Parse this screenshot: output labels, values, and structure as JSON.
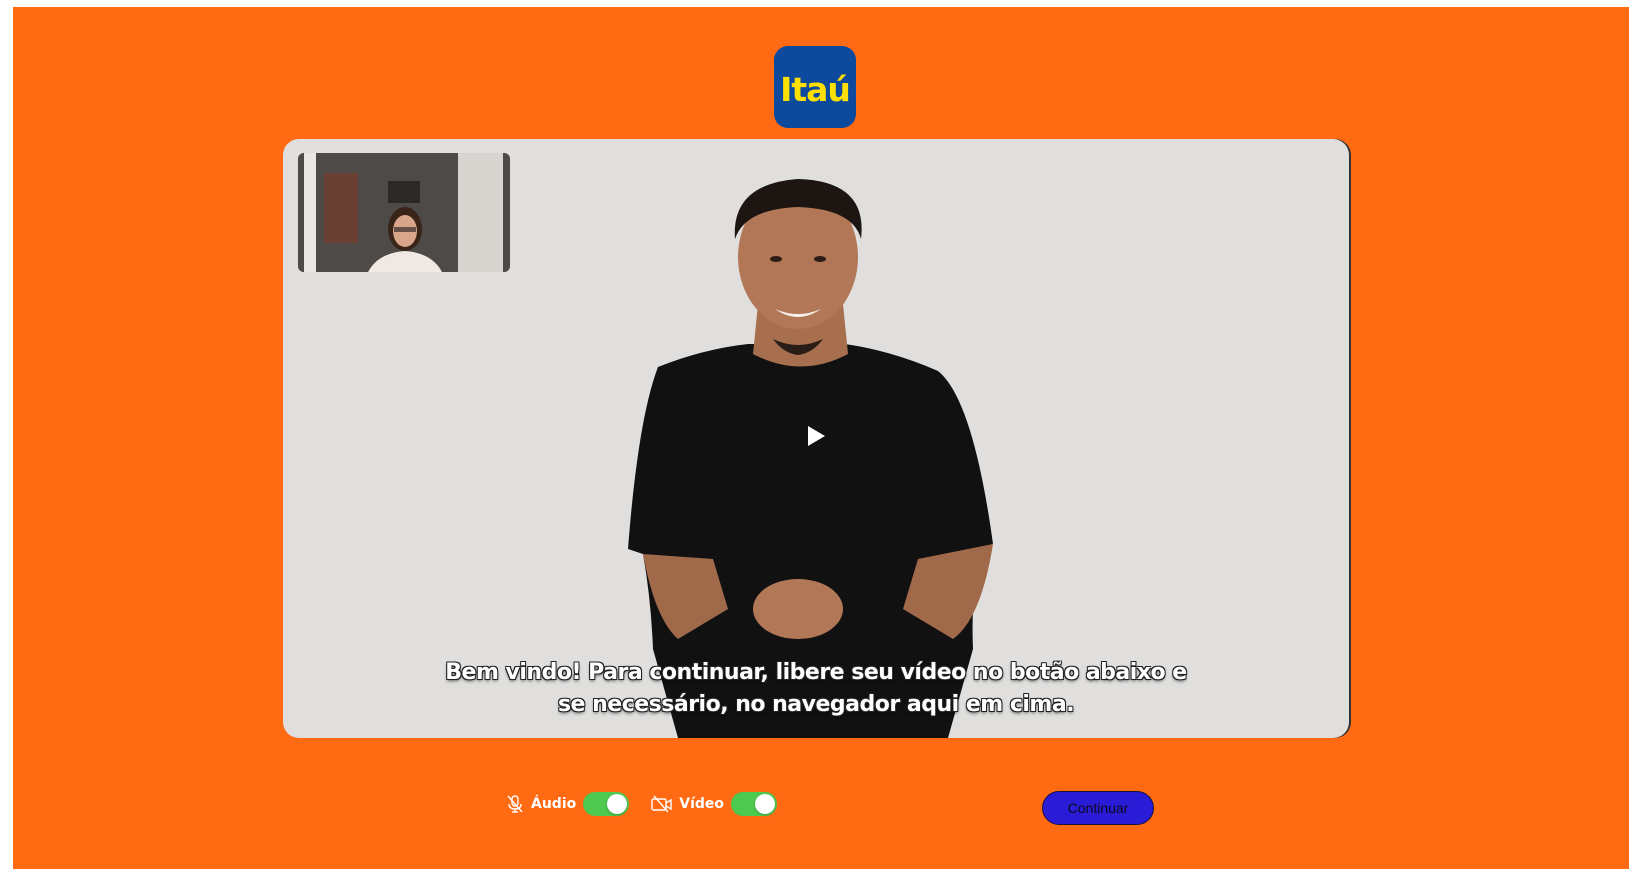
{
  "brand": {
    "logo_text": "Itaú",
    "logo_bg": "#0d4a9e",
    "logo_fg": "#ffe000"
  },
  "theme": {
    "page_bg": "#ff6a13",
    "player_bg": "#e0dfdd",
    "toggle_on": "#4cc94e",
    "button_bg": "#2a1bd6"
  },
  "player": {
    "subtitle_line1": "Bem vindo! Para continuar, libere seu vídeo no botão abaixo e",
    "subtitle_line2": "se necessário, no navegador aqui em cima.",
    "play_icon": "play-icon",
    "self_view_icon": "webcam-preview"
  },
  "controls": {
    "audio": {
      "label": "Áudio",
      "icon": "microphone-off-icon",
      "enabled": true
    },
    "video": {
      "label": "Vídeo",
      "icon": "camera-off-icon",
      "enabled": true
    },
    "continue_label": "Continuar"
  }
}
